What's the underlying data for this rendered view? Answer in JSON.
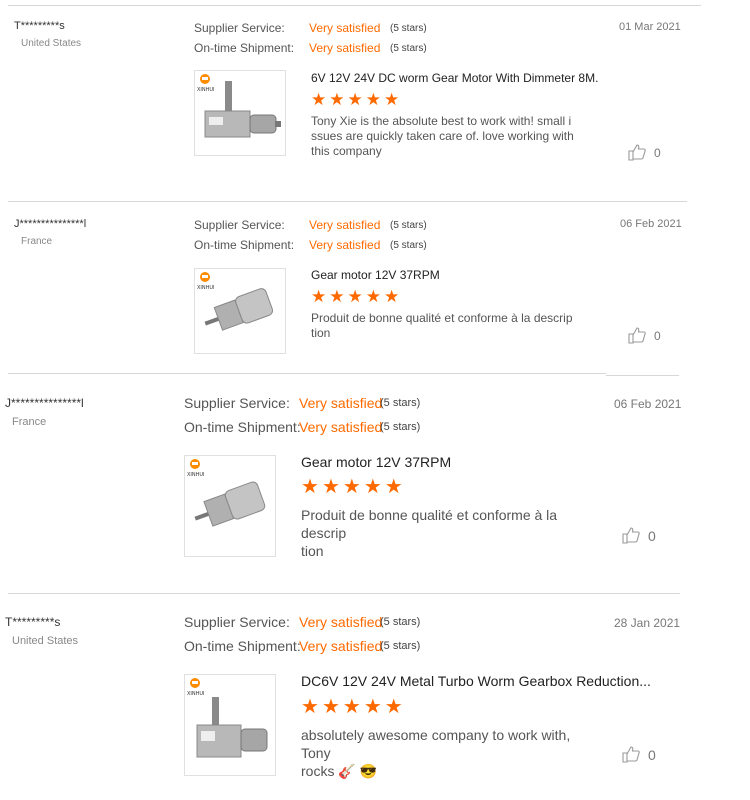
{
  "common": {
    "supplier_label": "Supplier Service:",
    "shipment_label": "On-time Shipment:",
    "satisfied": "Very satisfied",
    "stars_text": "(5 stars)",
    "brand": "XINHUI",
    "accent_color": "#ff6a00"
  },
  "reviews": [
    {
      "user": "T*********s",
      "country": "United States",
      "date": "01 Mar 2021",
      "product": "6V 12V 24V DC worm Gear Motor With Dimmeter 8M.",
      "rating": 5,
      "text_line1": "Tony Xie is the absolute best to work with! small i",
      "text_line2": "ssues are quickly taken care of. love working with",
      "text_line3": "this company",
      "likes": "0",
      "image": "worm-gear-motor"
    },
    {
      "user": "J***************l",
      "country": "France",
      "date": "06 Feb 2021",
      "product": "Gear motor 12V 37RPM",
      "rating": 5,
      "text_line1": "Produit de bonne qualité et conforme à la descrip",
      "text_line2": "tion",
      "likes": "0",
      "image": "cylinder-gear-motor"
    },
    {
      "user": "J***************l",
      "country": "France",
      "date": "06 Feb 2021",
      "product": "Gear motor 12V 37RPM",
      "rating": 5,
      "text_line1": "Produit de bonne qualité et conforme à la descrip",
      "text_line2": "tion",
      "likes": "0",
      "image": "cylinder-gear-motor"
    },
    {
      "user": "T*********s",
      "country": "United States",
      "date": "28 Jan 2021",
      "product": "DC6V 12V 24V Metal Turbo Worm Gearbox Reduction...",
      "rating": 5,
      "text_line1": "absolutely awesome company to work with,  Tony",
      "text_line2": "rocks",
      "emoji": "🎸 😎",
      "likes": "0",
      "image": "worm-gear-motor"
    }
  ]
}
